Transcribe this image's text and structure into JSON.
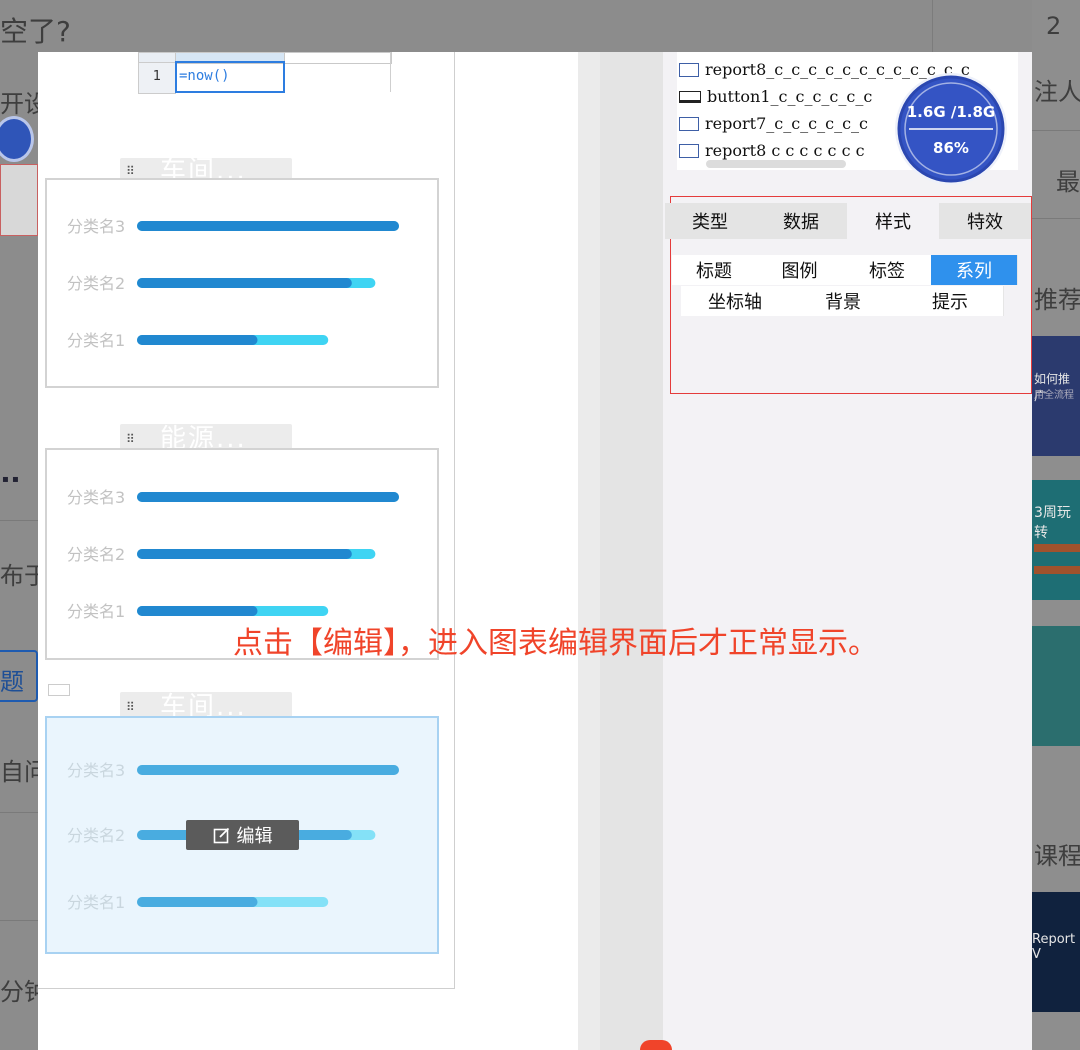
{
  "background": {
    "title_fragment": "空了?",
    "left_fragments": [
      "开设",
      "布于",
      "题",
      "自问",
      "分钟"
    ],
    "top_right_number": "2",
    "right_fragments": [
      "注人",
      "最",
      "推荐",
      "课程"
    ],
    "promo_texts": [
      "如何推广",
      "用全流程",
      "3周玩转",
      "Report V"
    ]
  },
  "sheet": {
    "row_number": "1",
    "cell_formula": "=now()"
  },
  "widgets": [
    {
      "title": "车间...",
      "categories": [
        "分类名3",
        "分类名2",
        "分类名1"
      ],
      "chart_data": {
        "type": "bar",
        "categories": [
          "分类名3",
          "分类名2",
          "分类名1"
        ],
        "series": [
          {
            "values": [
              1.0,
              0.91,
              0.73
            ]
          },
          {
            "values": [
              1.0,
              0.82,
              0.46
            ]
          }
        ],
        "xlim": [
          0,
          1
        ]
      }
    },
    {
      "title": "能源...",
      "categories": [
        "分类名3",
        "分类名2",
        "分类名1"
      ],
      "chart_data": {
        "type": "bar",
        "categories": [
          "分类名3",
          "分类名2",
          "分类名1"
        ],
        "series": [
          {
            "values": [
              1.0,
              0.91,
              0.73
            ]
          },
          {
            "values": [
              1.0,
              0.82,
              0.46
            ]
          }
        ],
        "xlim": [
          0,
          1
        ]
      }
    },
    {
      "title": "车间...",
      "categories": [
        "分类名3",
        "分类名2",
        "分类名1"
      ],
      "chart_data": {
        "type": "bar",
        "categories": [
          "分类名3",
          "分类名2",
          "分类名1"
        ],
        "series": [
          {
            "values": [
              1.0,
              0.91,
              0.73
            ]
          },
          {
            "values": [
              1.0,
              0.82,
              0.46
            ]
          }
        ],
        "xlim": [
          0,
          1
        ]
      }
    }
  ],
  "edit_button_label": "编辑",
  "components": [
    {
      "label": "report8_c_c_c_c_c_c_c_c_c_c_c_c",
      "icon": "checkbox-icon"
    },
    {
      "label": "button1_c_c_c_c_c_c",
      "icon": "button-icon"
    },
    {
      "label": "report7_c_c_c_c_c_c",
      "icon": "checkbox-icon"
    },
    {
      "label": "report8 c c c c c c c",
      "icon": "checkbox-icon"
    }
  ],
  "memory": {
    "usage": "1.6G /1.8G",
    "percent": "86%"
  },
  "prop_tabs": [
    "类型",
    "数据",
    "样式",
    "特效"
  ],
  "style_tabs_row1": [
    "标题",
    "图例",
    "标签",
    "系列"
  ],
  "style_tabs_row2": [
    "坐标轴",
    "背景",
    "提示"
  ],
  "active_style_tab": "系列",
  "annotation_note": "点击【编辑】，进入图表编辑界面后才正常显示。",
  "colors": {
    "bar_dark": "#2188d0",
    "bar_light": "#3fd4f3",
    "active_tab": "#2f91ed",
    "note": "#f0442a",
    "highlight_border": "#e43b3b"
  }
}
